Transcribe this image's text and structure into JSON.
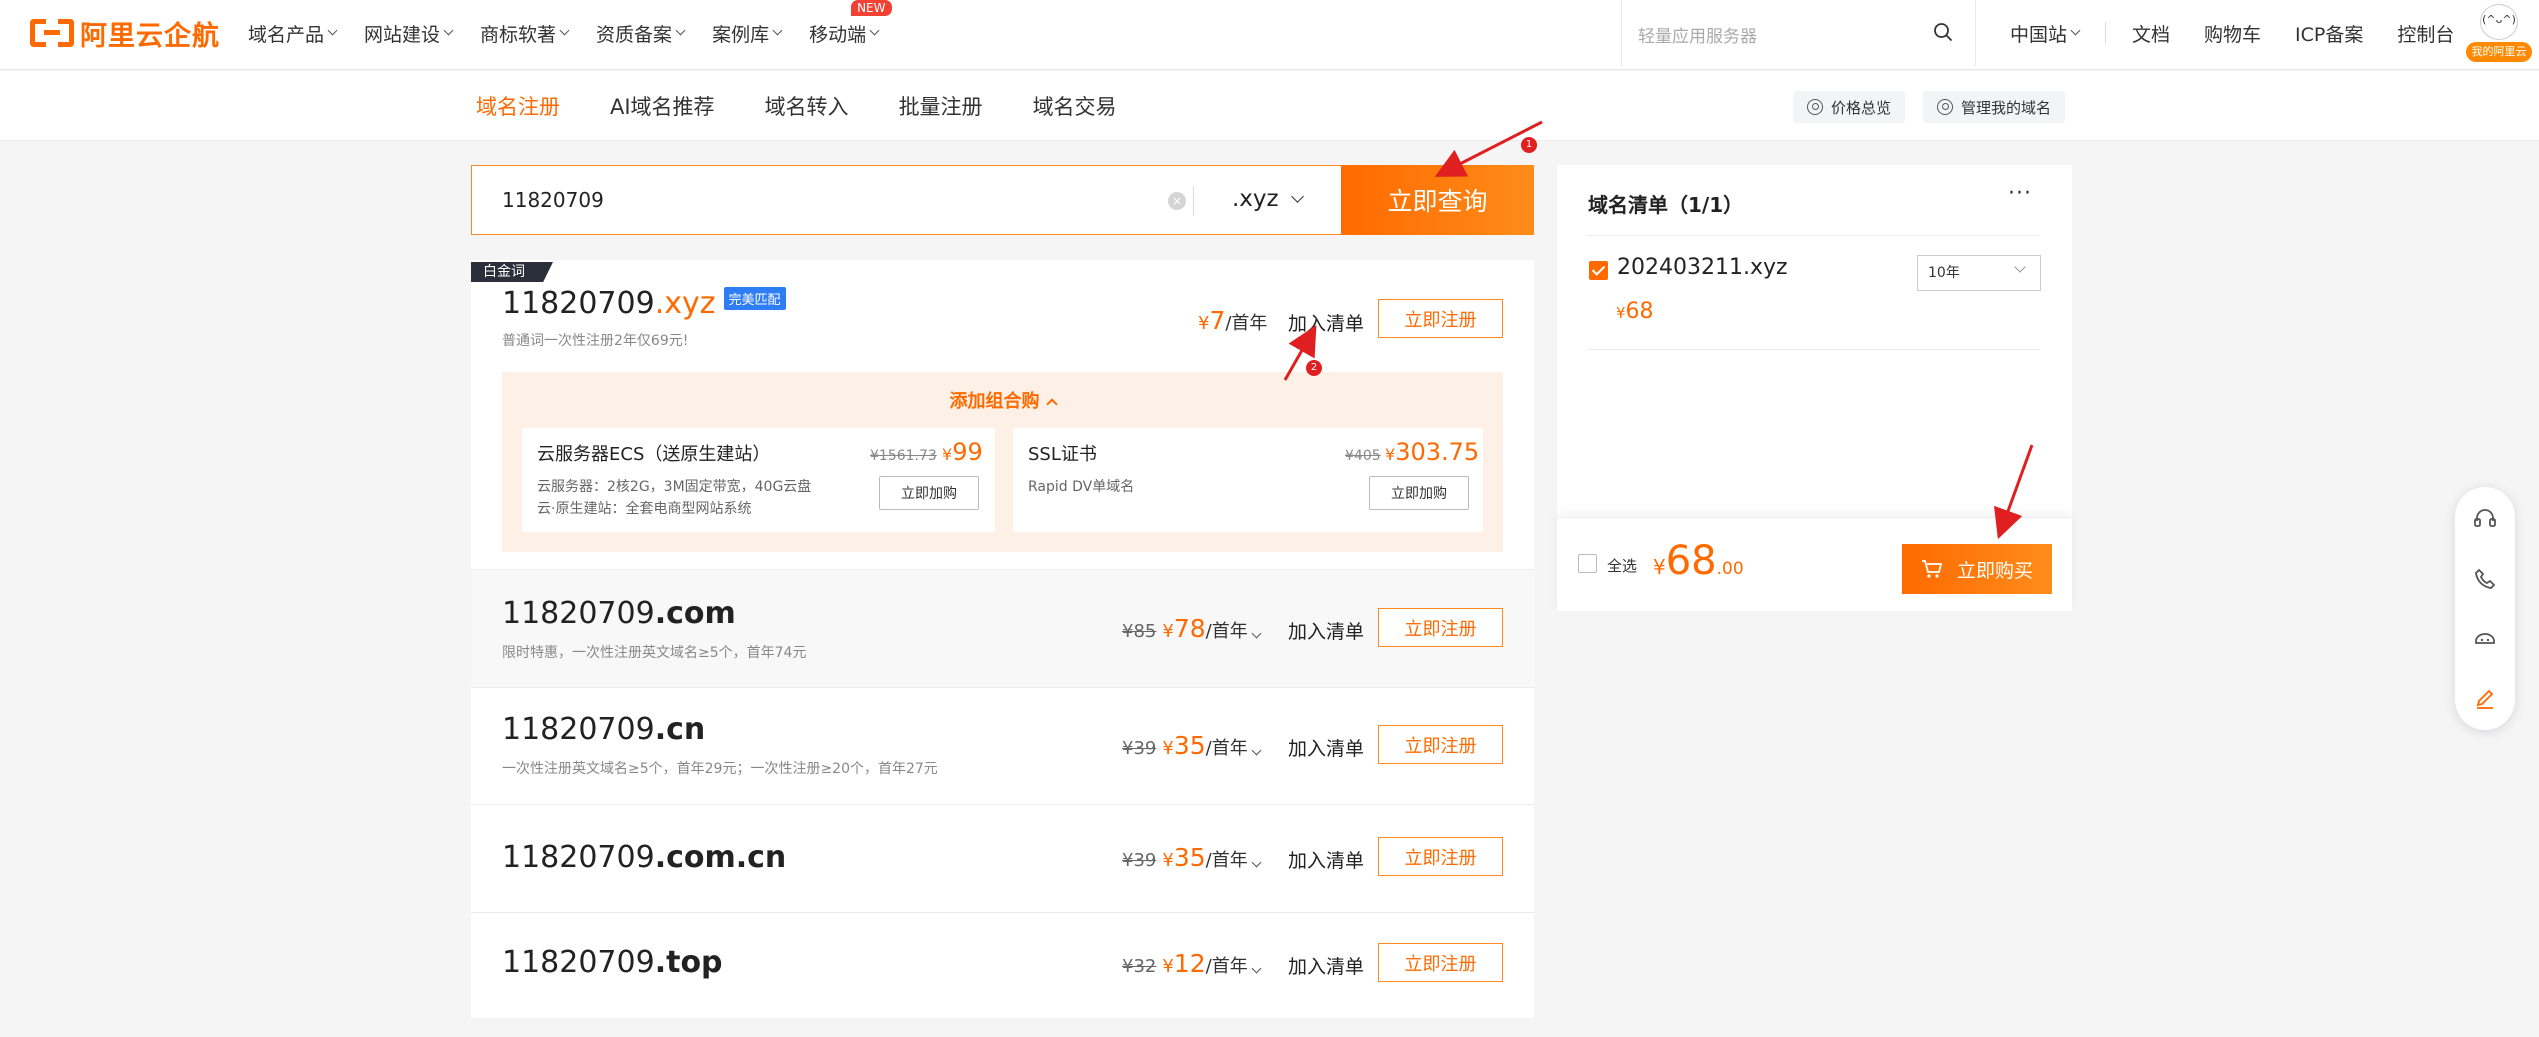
{
  "topnav": {
    "logo": "阿里云企航",
    "items": [
      {
        "label": "域名产品"
      },
      {
        "label": "网站建设"
      },
      {
        "label": "商标软著"
      },
      {
        "label": "资质备案"
      },
      {
        "label": "案例库"
      },
      {
        "label": "移动端",
        "badge": "NEW"
      }
    ],
    "search_placeholder": "轻量应用服务器",
    "right": {
      "region": "中国站",
      "docs": "文档",
      "cart": "购物车",
      "icp": "ICP备案",
      "console": "控制台"
    },
    "avatar": {
      "face": "(^ᴗ^)",
      "tag": "我的阿里云"
    }
  },
  "subnav": {
    "tabs": [
      {
        "label": "域名注册",
        "active": true
      },
      {
        "label": "AI域名推荐"
      },
      {
        "label": "域名转入"
      },
      {
        "label": "批量注册"
      },
      {
        "label": "域名交易"
      }
    ],
    "price_overview": "价格总览",
    "manage_domains": "管理我的域名"
  },
  "query": {
    "value": "11820709",
    "clear": "×",
    "suffix": ".xyz",
    "button": "立即查询"
  },
  "results": {
    "platinum_tag": "白金词",
    "primary": {
      "name": "11820709",
      "tld": ".xyz",
      "match_badge": "完美匹配",
      "note": "普通词一次性注册2年仅69元!",
      "currency": "¥",
      "price": "7",
      "unit": "/首年",
      "add_to_list": "加入清单",
      "register": "立即注册"
    },
    "combo": {
      "title": "添加组合购",
      "items": [
        {
          "name": "云服务器ECS（送原生建站）",
          "desc1": "云服务器：2核2G，3M固定带宽，40G云盘",
          "desc2": "云·原生建站：全套电商型网站系统",
          "old_price": "¥1561.73",
          "currency": "¥",
          "price": "99",
          "button": "立即加购"
        },
        {
          "name": "SSL证书",
          "desc1": "Rapid DV单域名",
          "old_price": "¥405",
          "currency": "¥",
          "price": "303.75",
          "button": "立即加购"
        }
      ]
    },
    "others": [
      {
        "name": "11820709",
        "tld": ".com",
        "note": "限时特惠，一次性注册英文域名≥5个，首年74元",
        "old": "¥85",
        "currency": "¥",
        "price": "78",
        "unit": "/首年",
        "add_to_list": "加入清单",
        "register": "立即注册"
      },
      {
        "name": "11820709",
        "tld": ".cn",
        "note": "一次性注册英文域名≥5个，首年29元；一次性注册≥20个，首年27元",
        "old": "¥39",
        "currency": "¥",
        "price": "35",
        "unit": "/首年",
        "add_to_list": "加入清单",
        "register": "立即注册"
      },
      {
        "name": "11820709",
        "tld": ".com.cn",
        "note": "",
        "old": "¥39",
        "currency": "¥",
        "price": "35",
        "unit": "/首年",
        "add_to_list": "加入清单",
        "register": "立即注册"
      },
      {
        "name": "11820709",
        "tld": ".top",
        "note": "",
        "old": "¥32",
        "currency": "¥",
        "price": "12",
        "unit": "/首年",
        "add_to_list": "加入清单",
        "register": "立即注册"
      }
    ]
  },
  "cart": {
    "title": "域名清单（1/1）",
    "more": "···",
    "item": {
      "domain": "202403211.xyz",
      "price": "68",
      "currency": "¥",
      "years": "10年",
      "checked": true
    },
    "select_all": "全选",
    "total_currency": "¥",
    "total_int": "68",
    "total_dec": ".00",
    "buy": "立即购买"
  },
  "float_toolbar": {
    "icons": [
      "headset-icon",
      "phone-icon",
      "robot-icon",
      "edit-icon"
    ]
  },
  "annotations": {
    "markers": [
      "1",
      "2"
    ],
    "arrow_color": "#e02020"
  },
  "colors": {
    "accent": "#ff6a00",
    "text": "#333333",
    "background": "#f5f5f6"
  }
}
